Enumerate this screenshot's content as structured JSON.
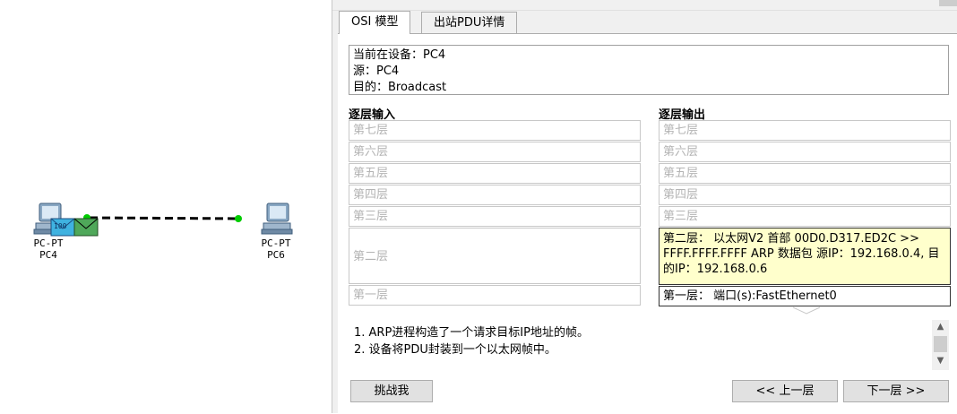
{
  "topology": {
    "pc4": {
      "type": "PC-PT",
      "name": "PC4"
    },
    "pc6": {
      "type": "PC-PT",
      "name": "PC6"
    },
    "link_color": "#000000",
    "link_light_color": "#00cc00",
    "pdu_color": "#4fa85a"
  },
  "tabs": [
    {
      "label": "OSI 模型",
      "active": true
    },
    {
      "label": "出站PDU详情",
      "active": false
    }
  ],
  "info": {
    "device_line": "当前在设备：PC4",
    "source_line": "源：PC4",
    "dest_line": "目的：Broadcast"
  },
  "in_layers": {
    "header": "逐层输入",
    "items": [
      "第七层",
      "第六层",
      "第五层",
      "第四层",
      "第三层",
      "第二层",
      "第一层"
    ]
  },
  "out_layers": {
    "header": "逐层输出",
    "items": [
      "第七层",
      "第六层",
      "第五层",
      "第四层",
      "第三层",
      "第二层： 以太网V2 首部 00D0.D317.ED2C >> FFFF.FFFF.FFFF ARP 数据包 源IP：192.168.0.4, 目的IP：192.168.0.6",
      "第一层： 端口(s):FastEthernet0"
    ]
  },
  "description": [
    "1. ARP进程构造了一个请求目标IP地址的帧。",
    "2. 设备将PDU封装到一个以太网帧中。"
  ],
  "buttons": {
    "challenge": "挑战我",
    "prev": "<< 上一层",
    "next": "下一层 >>"
  },
  "colors": {
    "highlight_bg": "#ffffcc",
    "dialog_bg": "#f0f0f0"
  }
}
